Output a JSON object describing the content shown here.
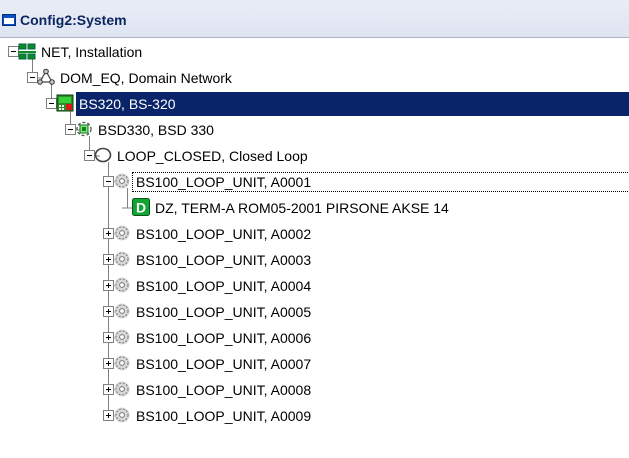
{
  "window": {
    "title": "Config2:System"
  },
  "tree": {
    "nodes": [
      {
        "label": "NET, Installation",
        "icon": "network-icon",
        "expanded": true
      },
      {
        "label": "DOM_EQ, Domain Network",
        "icon": "domain-network-icon",
        "expanded": true
      },
      {
        "label": "BS320, BS-320",
        "icon": "controller-icon",
        "expanded": true,
        "selected": true
      },
      {
        "label": "BSD330, BSD 330",
        "icon": "loop-driver-icon",
        "expanded": true
      },
      {
        "label": "LOOP_CLOSED, Closed Loop",
        "icon": "closed-loop-icon",
        "expanded": true
      },
      {
        "label": "BS100_LOOP_UNIT, A0001",
        "icon": "loop-unit-icon",
        "expanded": true,
        "focused": true
      },
      {
        "label": "DZ, TERM-A ROM05-2001 PIRSONE AKSE 14",
        "icon": "detection-zone-icon",
        "leaf": true
      },
      {
        "label": "BS100_LOOP_UNIT, A0002",
        "icon": "loop-unit-icon",
        "expanded": false
      },
      {
        "label": "BS100_LOOP_UNIT, A0003",
        "icon": "loop-unit-icon",
        "expanded": false
      },
      {
        "label": "BS100_LOOP_UNIT, A0004",
        "icon": "loop-unit-icon",
        "expanded": false
      },
      {
        "label": "BS100_LOOP_UNIT, A0005",
        "icon": "loop-unit-icon",
        "expanded": false
      },
      {
        "label": "BS100_LOOP_UNIT, A0006",
        "icon": "loop-unit-icon",
        "expanded": false
      },
      {
        "label": "BS100_LOOP_UNIT, A0007",
        "icon": "loop-unit-icon",
        "expanded": false
      },
      {
        "label": "BS100_LOOP_UNIT, A0008",
        "icon": "loop-unit-icon",
        "expanded": false
      },
      {
        "label": "BS100_LOOP_UNIT, A0009",
        "icon": "loop-unit-icon",
        "expanded": false
      }
    ]
  },
  "colors": {
    "selection": "#0a246a",
    "title_text": "#0b255f",
    "zone_green": "#12a534"
  }
}
